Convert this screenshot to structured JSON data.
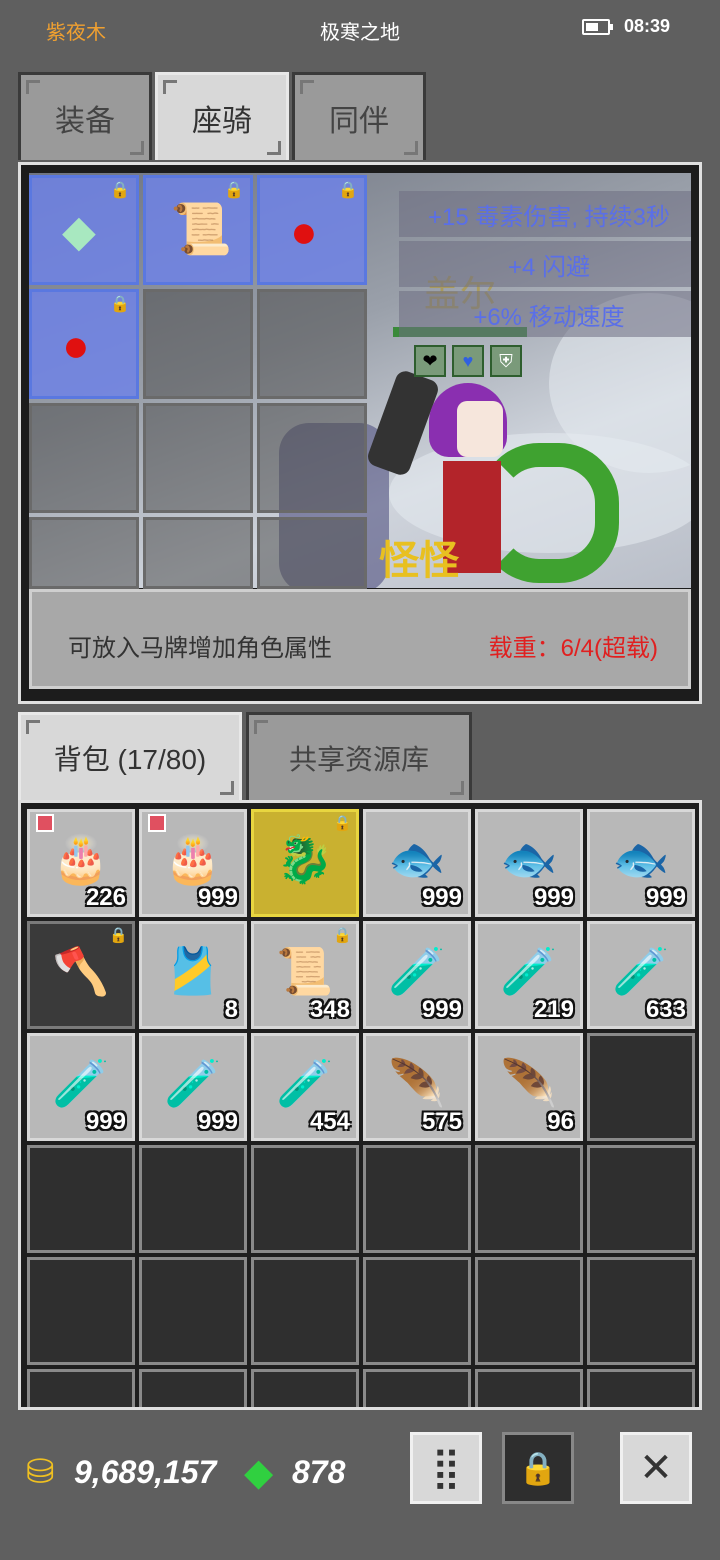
{
  "status": {
    "player": "紫夜木",
    "map": "极寒之地",
    "time": "08:39"
  },
  "tabs": {
    "equip": "装备",
    "mount": "座骑",
    "companion": "同伴"
  },
  "mount": {
    "stats": [
      "+15 毒素伤害, 持续3秒",
      "+4 闪避",
      "+6% 移动速度"
    ],
    "hero_name": "盖尔",
    "monster_name": "怪怪",
    "buffs": [
      "heart-icon",
      "blue-heart-icon",
      "shield-icon"
    ],
    "hint": "可放入马牌增加角色属性",
    "load": "载重：6/4(超载)"
  },
  "inventory_tabs": {
    "bag": "背包 (17/80)",
    "shared": "共享资源库"
  },
  "inventory": [
    {
      "icon": "🎂",
      "count": "226",
      "badge": true
    },
    {
      "icon": "🎂",
      "count": "999",
      "badge": true
    },
    {
      "icon": "🐉",
      "count": "",
      "locked": true,
      "style": "gold"
    },
    {
      "icon": "🐟",
      "count": "999"
    },
    {
      "icon": "🐟",
      "count": "999"
    },
    {
      "icon": "🐟",
      "count": "999"
    },
    {
      "icon": "🪓",
      "count": "",
      "locked": true,
      "style": "dark"
    },
    {
      "icon": "🎽",
      "count": "8"
    },
    {
      "icon": "📜",
      "count": "348",
      "locked": true
    },
    {
      "icon": "🧪",
      "count": "999",
      "color": "#3060e0"
    },
    {
      "icon": "🧪",
      "count": "219",
      "color": "#3060e0"
    },
    {
      "icon": "🧪",
      "count": "633",
      "color": "#e03030"
    },
    {
      "icon": "🧪",
      "count": "999",
      "color": "#3060e0"
    },
    {
      "icon": "🧪",
      "count": "999",
      "color": "#3060e0"
    },
    {
      "icon": "🧪",
      "count": "454",
      "color": "#e03030"
    },
    {
      "icon": "🪶",
      "count": "575",
      "color": "#3090e0"
    },
    {
      "icon": "🪶",
      "count": "96",
      "color": "#e04020"
    }
  ],
  "currency": {
    "gold": "9,689,157",
    "gems": "878"
  }
}
